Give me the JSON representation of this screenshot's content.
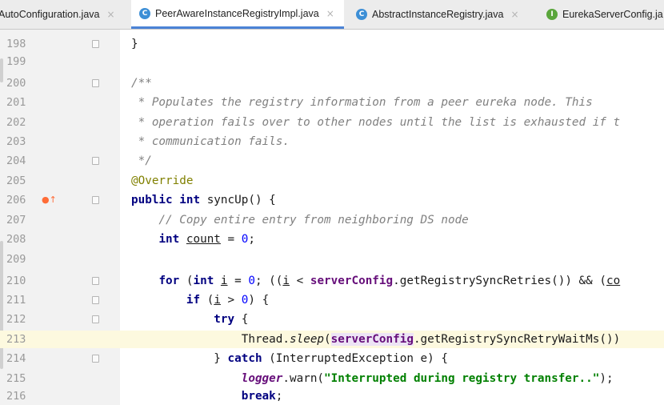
{
  "tabs": [
    {
      "label": "AutoConfiguration.java",
      "badge": "",
      "active": false
    },
    {
      "label": "PeerAwareInstanceRegistryImpl.java",
      "badge": "C",
      "active": true
    },
    {
      "label": "AbstractInstanceRegistry.java",
      "badge": "C",
      "active": false
    },
    {
      "label": "EurekaServerConfig.ja",
      "badge": "I",
      "active": false
    }
  ],
  "tab_close_glyph": "×",
  "gutter_marker": "●↑",
  "lines": [
    {
      "num": "198"
    },
    {
      "num": "199"
    },
    {
      "num": "200"
    },
    {
      "num": "201"
    },
    {
      "num": "202"
    },
    {
      "num": "203"
    },
    {
      "num": "204"
    },
    {
      "num": "205"
    },
    {
      "num": "206"
    },
    {
      "num": "207"
    },
    {
      "num": "208"
    },
    {
      "num": "209"
    },
    {
      "num": "210"
    },
    {
      "num": "211"
    },
    {
      "num": "212"
    },
    {
      "num": "213"
    },
    {
      "num": "214"
    },
    {
      "num": "215"
    },
    {
      "num": "216"
    }
  ],
  "code": {
    "l198": {
      "brace": "}"
    },
    "l200": {
      "comment": "/**"
    },
    "l201": {
      "comment": " * Populates the registry information from a peer eureka node. This"
    },
    "l202": {
      "comment": " * operation fails over to other nodes until the list is exhausted if t"
    },
    "l203": {
      "comment": " * communication fails."
    },
    "l204": {
      "comment": " */"
    },
    "l205": {
      "annotation": "@Override"
    },
    "l206": {
      "kw1": "public",
      "kw2": "int",
      "rest": " syncUp() {"
    },
    "l207": {
      "comment": "    // Copy entire entry from neighboring DS node"
    },
    "l208": {
      "indent": "    ",
      "kw": "int",
      "space": " ",
      "var": "count",
      "eq": " = ",
      "num": "0",
      "end": ";"
    },
    "l210": {
      "indent": "    ",
      "kw_for": "for",
      "p1": " (",
      "kw_int": "int",
      "sp": " ",
      "var": "i",
      "eq": " = ",
      "num": "0",
      "p2": "; ((",
      "var2": "i",
      "lt": " < ",
      "field": "serverConfig",
      "call": ".getRegistrySyncRetries()) && (",
      "tail": "co"
    },
    "l211": {
      "indent": "        ",
      "kw": "if",
      "p1": " (",
      "var": "i",
      "gt": " > ",
      "num": "0",
      "end": ") {"
    },
    "l212": {
      "indent": "            ",
      "kw": "try",
      "end": " {"
    },
    "l213": {
      "indent": "                ",
      "cls": "Thread.",
      "method": "sleep",
      "p1": "(",
      "field": "serverConfig",
      "call": ".getRegistrySyncRetryWaitMs())"
    },
    "l214": {
      "indent": "            ",
      "close": "} ",
      "kw": "catch",
      "rest": " (InterruptedException e) {"
    },
    "l215": {
      "indent": "                ",
      "sfield": "logger",
      "call": ".warn(",
      "str": "\"Interrupted during registry transfer..\"",
      "end": ");"
    },
    "l216": {
      "indent": "                ",
      "kw": "break",
      "end": ";"
    }
  }
}
